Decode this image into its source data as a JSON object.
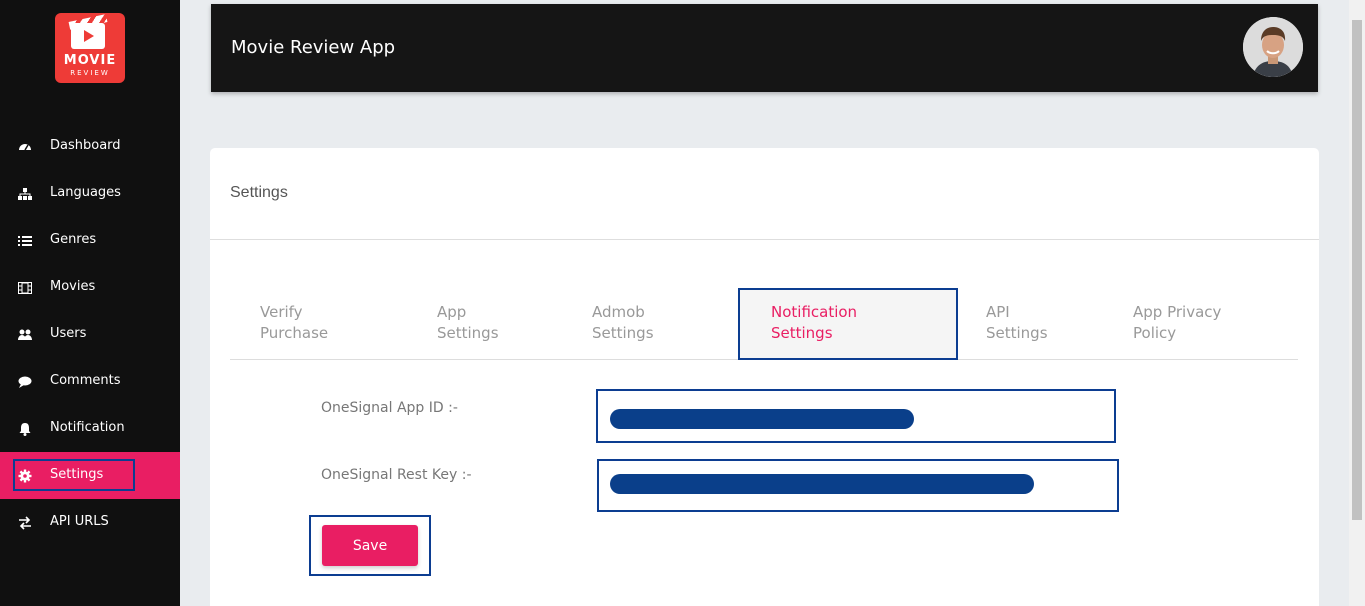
{
  "app": {
    "title": "Movie Review App"
  },
  "logo": {
    "line1": "MOVIE",
    "line2": "REVIEW"
  },
  "sidebar": {
    "items": [
      {
        "label": "Dashboard",
        "icon": "dashboard-icon"
      },
      {
        "label": "Languages",
        "icon": "sitemap-icon"
      },
      {
        "label": "Genres",
        "icon": "list-icon"
      },
      {
        "label": "Movies",
        "icon": "film-icon"
      },
      {
        "label": "Users",
        "icon": "users-icon"
      },
      {
        "label": "Comments",
        "icon": "comments-icon"
      },
      {
        "label": "Notification",
        "icon": "bell-icon"
      },
      {
        "label": "Settings",
        "icon": "gear-icon",
        "active": true
      },
      {
        "label": "API URLS",
        "icon": "exchange-icon"
      }
    ]
  },
  "settings": {
    "title": "Settings",
    "tabs": [
      {
        "line1": "Verify",
        "line2": "Purchase"
      },
      {
        "line1": "App",
        "line2": "Settings"
      },
      {
        "line1": "Admob",
        "line2": "Settings"
      },
      {
        "line1": "Notification",
        "line2": "Settings",
        "active": true
      },
      {
        "line1": "API",
        "line2": "Settings"
      },
      {
        "line1": "App Privacy",
        "line2": "Policy"
      }
    ],
    "fields": {
      "app_id_label": "OneSignal App ID :-",
      "rest_key_label": "OneSignal Rest Key :-"
    },
    "save_label": "Save"
  },
  "colors": {
    "accent": "#e91e63",
    "sidebar_bg": "#101010",
    "header_bg": "#151515",
    "highlight_outline": "#0c3d91",
    "redaction": "#0a3f8a"
  }
}
